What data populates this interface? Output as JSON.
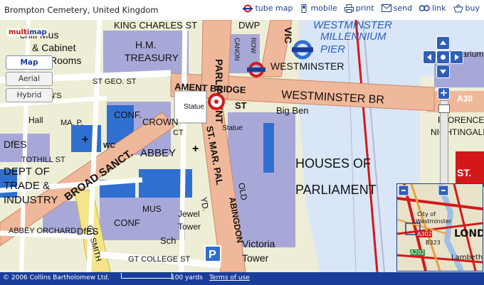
{
  "header": {
    "location": "Brompton Cemetery, United Kingdom"
  },
  "toolbar": {
    "tube_map": "tube map",
    "mobile": "mobile",
    "print": "print",
    "send": "send",
    "link": "link",
    "buy": "buy"
  },
  "logo": {
    "part1": "multi",
    "part2": "map"
  },
  "map_types": {
    "map": "Map",
    "aerial": "Aerial",
    "hybrid": "Hybrid",
    "selected": "Map"
  },
  "map_labels": {
    "westminster_millennium": "WESTMINSTER",
    "millennium": "MILLENNIUM",
    "pier": "PIER",
    "westminster": "WESTMINSTER",
    "westminster_bridge": "WESTMINSTER BR",
    "bridge_part": "AMENT  BRIDGE",
    "big_ben": "Big Ben",
    "houses_of": "HOUSES OF",
    "parliament": "PARLIAMENT",
    "victoria": "Victoria",
    "tower": "Tower",
    "jewel": "Jewel",
    "jewel_tower": "Tower",
    "abbey": "ABBEY",
    "broad_sanct": "BROAD SANCT.",
    "dept_of": "DEPT OF",
    "trade_industry_1": "TRADE &",
    "trade_industry_2": "INDUSTRY",
    "king_charles": "KING CHARLES ST",
    "hm": "H.M.",
    "treasury": "TREASURY",
    "parliament_st": "PARLIAMENT",
    "chill_mus": "chill Mus",
    "cabinet": "& Cabinet",
    "rooms": "Rooms",
    "st_geo": "ST GEO. ST",
    "conf_1": "CONF.",
    "conf_crown": "CROWN",
    "conf_2": "CONF",
    "dfes_1": "DfES",
    "dfes_2": "DfES",
    "tothill": "TOTHILL ST",
    "abbey_orchard": "ABBEY ORCHARD",
    "mus": "MUS",
    "sch": "Sch",
    "gt_college": "GT COLLEGE ST",
    "statue": "Statue",
    "wc": "WC",
    "aquarium": "Aquarium",
    "florence": "FLORENCE",
    "nightingale": "NIGHTINGALE",
    "a30": "A30",
    "st": "ST.",
    "dwp": "DWP",
    "canon_row": "CANON",
    "row": "ROW",
    "vic": "VIC",
    "mar_pal": "ST. MAR.  PAL",
    "abingdon": "ABINGDON",
    "old": "OLD",
    "yd": "YD.",
    "queens": "QUEEN'S",
    "hall": "Hall",
    "s_st": "S.",
    "st_label": "ST",
    "crown_ct": "CT",
    "gt_smith": "GT SMITH",
    "ma_p": "MA. P."
  },
  "overview": {
    "city_of": "City of",
    "westminster": "Westminster",
    "lond": "LOND",
    "lambeth": "Lambeth",
    "a302": "A302",
    "b323": "B323",
    "a202": "A202"
  },
  "footer": {
    "copyright": "© 2006 Collins Bartholomew Ltd.",
    "scale_label": "100 yards",
    "terms": "Terms of use"
  },
  "colors": {
    "water": "#d8e6f8",
    "road_main": "#f0b89a",
    "building_blue": "#2f6fd0",
    "building_purple": "#a8a8d8",
    "footer": "#1a3d9a",
    "accent_red": "#d41818"
  }
}
